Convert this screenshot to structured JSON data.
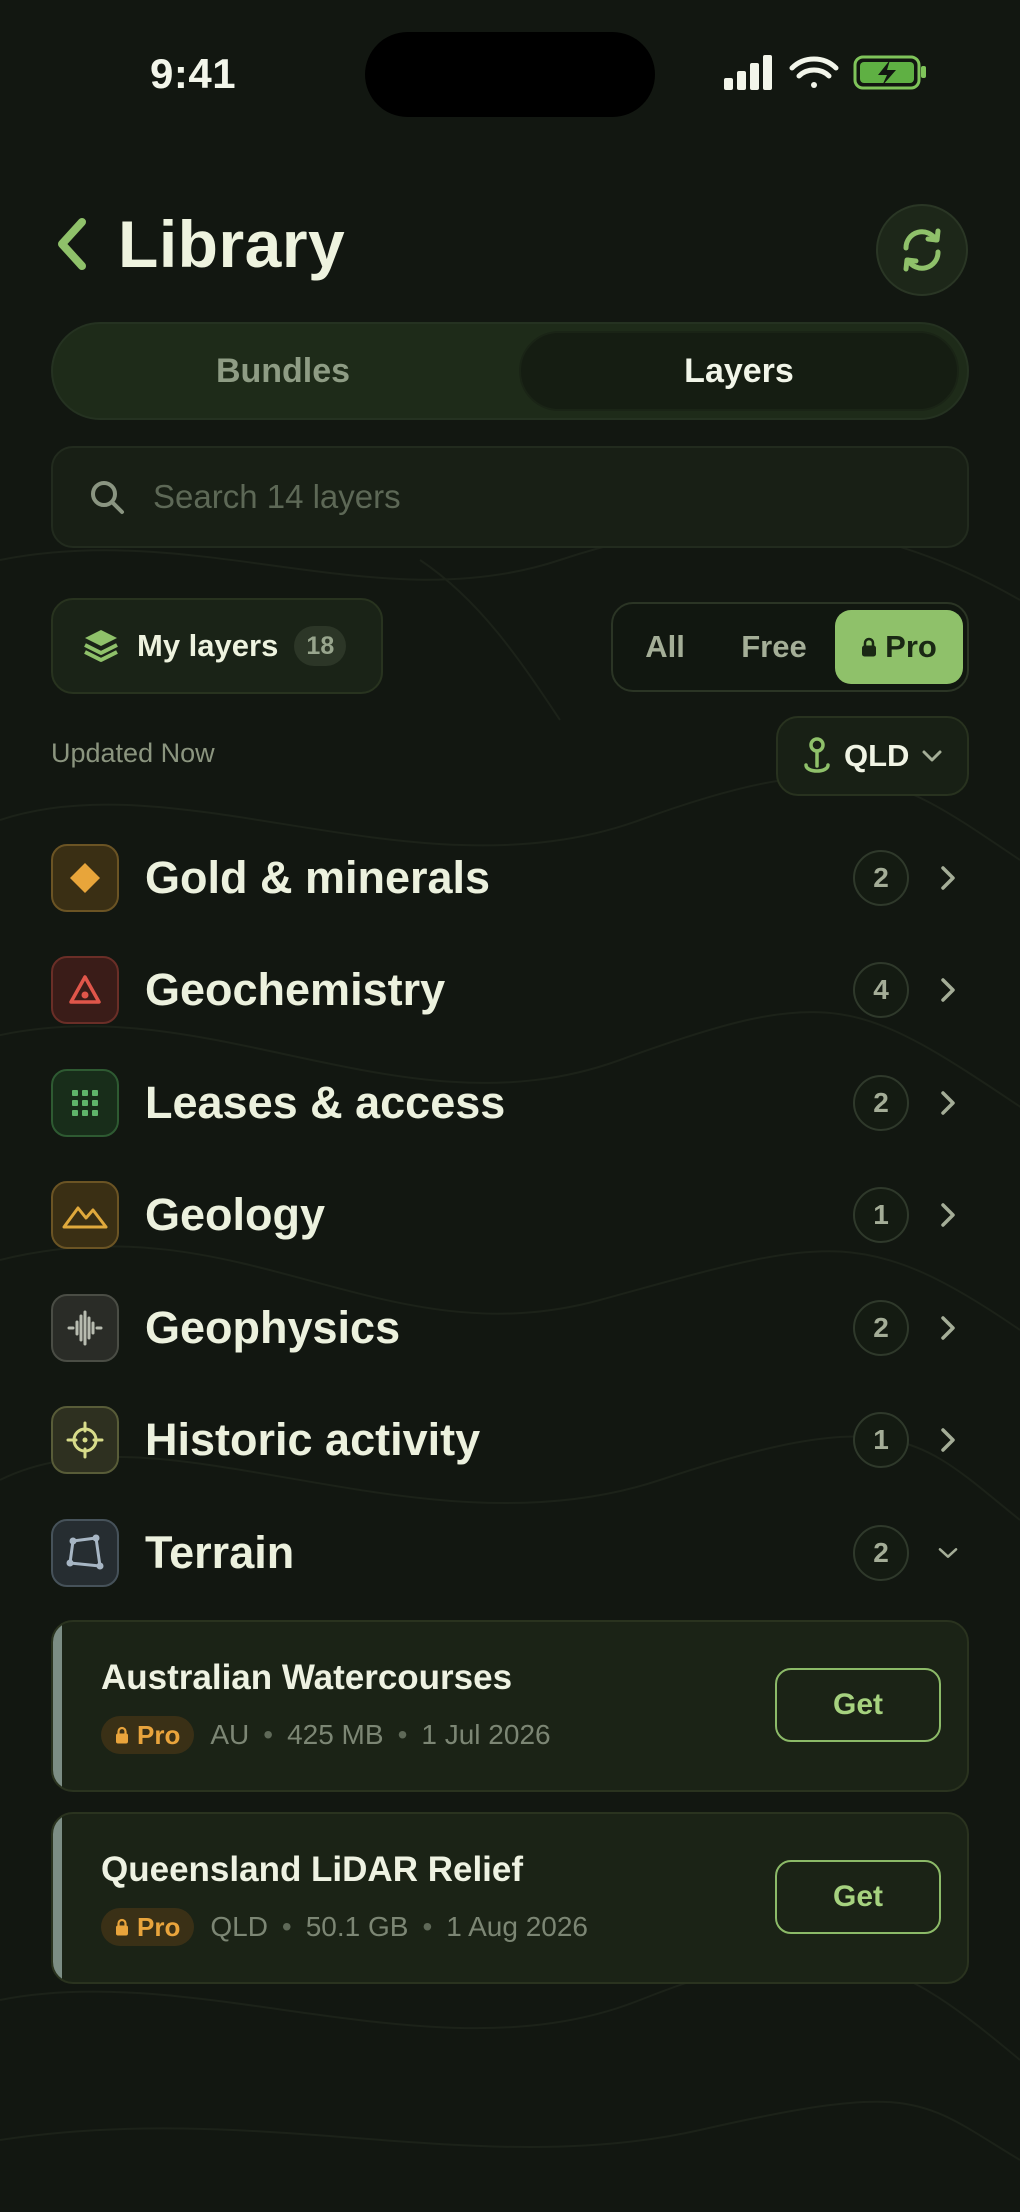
{
  "status_bar": {
    "time": "9:41"
  },
  "header": {
    "title": "Library"
  },
  "tabs": [
    {
      "label": "Bundles",
      "selected": false
    },
    {
      "label": "Layers",
      "selected": true
    }
  ],
  "search": {
    "placeholder": "Search 14 layers",
    "value": ""
  },
  "my_layers": {
    "label": "My layers",
    "count": "18"
  },
  "filter": {
    "options": [
      "All",
      "Free",
      "Pro"
    ],
    "selected": "Pro"
  },
  "updated": "Updated Now",
  "region": {
    "label": "QLD"
  },
  "categories": [
    {
      "label": "Gold & minerals",
      "count": "2",
      "icon": "diamond-icon",
      "color": "#e8a53a",
      "expanded": false
    },
    {
      "label": "Geochemistry",
      "count": "4",
      "icon": "flask-warning-icon",
      "color": "#e0564a",
      "expanded": false
    },
    {
      "label": "Leases & access",
      "count": "2",
      "icon": "grid-icon",
      "color": "#5fb46a",
      "expanded": false
    },
    {
      "label": "Geology",
      "count": "1",
      "icon": "mountains-icon",
      "color": "#e0a93c",
      "expanded": false
    },
    {
      "label": "Geophysics",
      "count": "2",
      "icon": "waveform-icon",
      "color": "#b8bcb0",
      "expanded": false
    },
    {
      "label": "Historic activity",
      "count": "1",
      "icon": "crosshair-icon",
      "color": "#d8dc8a",
      "expanded": false
    },
    {
      "label": "Terrain",
      "count": "2",
      "icon": "polygon-icon",
      "color": "#a7b6c4",
      "expanded": true
    }
  ],
  "layers": [
    {
      "name": "Australian Watercourses",
      "badge": "Pro",
      "region": "AU",
      "size": "425 MB",
      "date": "1 Jul 2026",
      "action": "Get"
    },
    {
      "name": "Queensland LiDAR Relief",
      "badge": "Pro",
      "region": "QLD",
      "size": "50.1 GB",
      "date": "1 Aug 2026",
      "action": "Get"
    }
  ],
  "colors": {
    "background": "#121711",
    "accent_green": "#8fc16a",
    "pro_orange": "#e9a43c"
  }
}
